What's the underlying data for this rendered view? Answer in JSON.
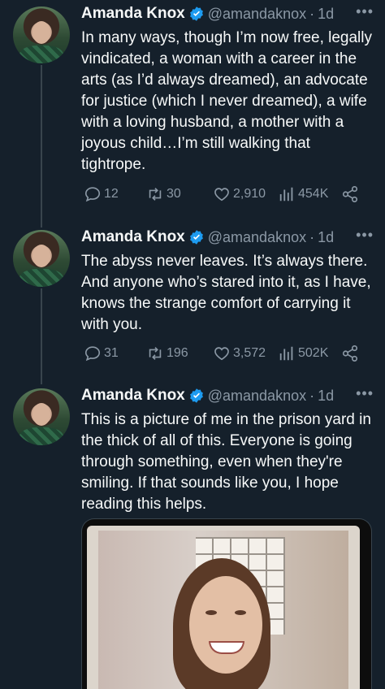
{
  "author": {
    "name": "Amanda Knox",
    "handle": "@amandaknox",
    "separator": "·"
  },
  "tweets": [
    {
      "time": "1d",
      "text": "In many ways, though I’m now free, legally vindicated, a woman with a career in the arts (as I’d always dreamed), an advocate for justice (which I never dreamed), a wife with a loving husband, a mother with a joyous child…I’m still walking that tightrope.",
      "replies": "12",
      "retweets": "30",
      "likes": "2,910",
      "views": "454K"
    },
    {
      "time": "1d",
      "text": "The abyss never leaves. It’s always there. And anyone who’s stared into it, as I have, knows the strange comfort of carrying it with you.",
      "replies": "31",
      "retweets": "196",
      "likes": "3,572",
      "views": "502K"
    },
    {
      "time": "1d",
      "text": "This is a picture of me in the prison yard in the thick of all of this. Everyone is going through something, even when they're smiling. If that sounds like you, I hope reading this helps."
    }
  ],
  "icons": {
    "more": "more-icon",
    "verified": "verified-badge-icon",
    "reply": "reply-icon",
    "retweet": "retweet-icon",
    "like": "like-icon",
    "views": "views-icon",
    "share": "share-icon"
  },
  "colors": {
    "background": "#15202b",
    "text_primary": "#f7f9f9",
    "text_secondary": "#8b98a5",
    "verified_blue": "#1d9bf0",
    "thread_line": "#38444d"
  }
}
